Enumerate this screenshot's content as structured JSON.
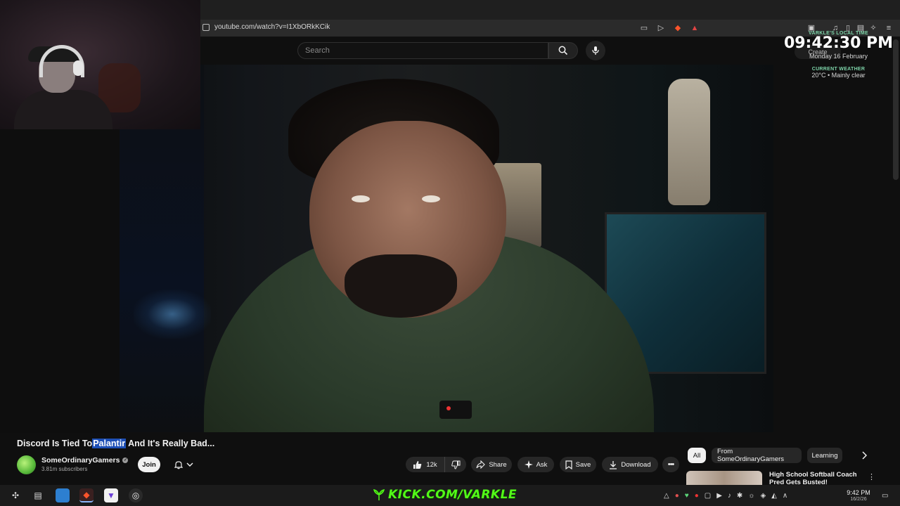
{
  "browser": {
    "url": "youtube.com/watch?v=I1XbORkKCik"
  },
  "youtube": {
    "search_placeholder": "Search",
    "video": {
      "title_before": "Discord Is Tied To",
      "title_highlight": "Palantir",
      "title_after": " And It's Really Bad...",
      "channel_name": "SomeOrdinaryGamers",
      "subscribers": "3.81m subscribers",
      "join_label": "Join",
      "like_count": "12k",
      "share_label": "Share",
      "ask_label": "Ask",
      "save_label": "Save",
      "download_label": "Download"
    },
    "chips": [
      "All",
      "From SomeOrdinaryGamers",
      "Learning"
    ],
    "recommendation": {
      "title": "High School Softball Coach Pred Gets Busted!"
    },
    "create_label": "Create"
  },
  "stream_overlay": {
    "clock_label": "VARKLE'S LOCAL TIME",
    "time": "09:42:30 PM",
    "date": "Monday 16 February",
    "weather_label": "CURRENT WEATHER",
    "weather": "20°C • Mainly clear",
    "kick_banner": "KICK.COM/VARKLE"
  },
  "taskbar": {
    "time": "9:42 PM",
    "date": "16/2/26"
  },
  "colors": {
    "accent_green": "#53fc18",
    "highlight_blue": "#1d4fb5",
    "overlay_label_green": "#7dd3a8"
  }
}
